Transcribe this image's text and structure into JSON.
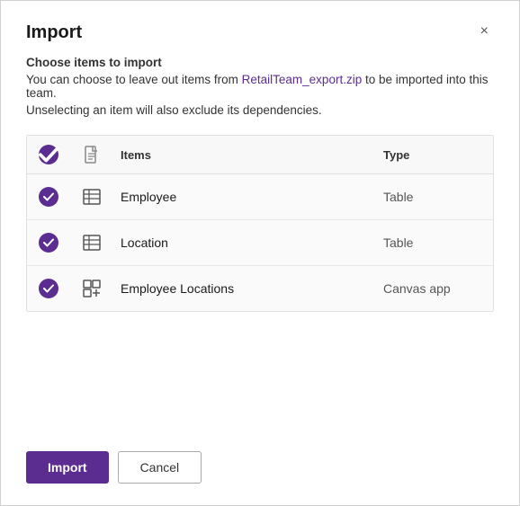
{
  "dialog": {
    "title": "Import",
    "close_label": "×"
  },
  "content": {
    "heading": "Choose items to import",
    "description_part1": "You can choose to leave out items from ",
    "file_link": "RetailTeam_export.zip",
    "description_part2": " to be imported into this team.",
    "note": "Unselecting an item will also exclude its dependencies."
  },
  "table": {
    "columns": [
      {
        "key": "checkbox",
        "label": ""
      },
      {
        "key": "icon",
        "label": ""
      },
      {
        "key": "items",
        "label": "Items"
      },
      {
        "key": "type",
        "label": "Type"
      }
    ],
    "rows": [
      {
        "id": 1,
        "name": "Employee",
        "type": "Table",
        "icon": "table",
        "checked": true
      },
      {
        "id": 2,
        "name": "Location",
        "type": "Table",
        "icon": "table",
        "checked": true
      },
      {
        "id": 3,
        "name": "Employee Locations",
        "type": "Canvas app",
        "icon": "canvas",
        "checked": true
      }
    ]
  },
  "footer": {
    "import_label": "Import",
    "cancel_label": "Cancel"
  }
}
